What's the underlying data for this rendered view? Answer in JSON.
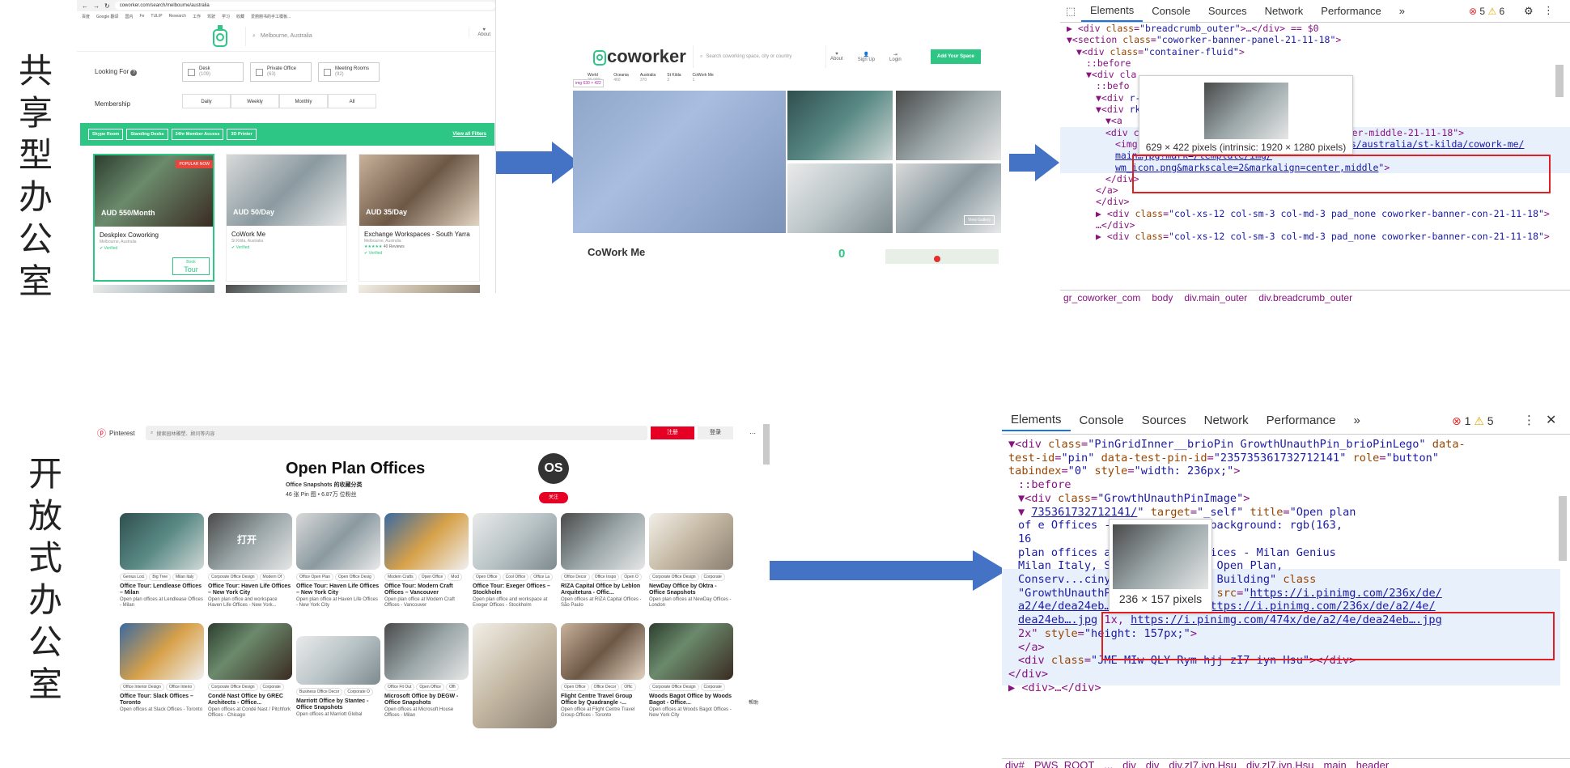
{
  "labels": {
    "top": [
      "共",
      "享",
      "型",
      "办",
      "公",
      "室"
    ],
    "bottom": [
      "开",
      "放",
      "式",
      "办",
      "公",
      "室"
    ]
  },
  "colors": {
    "arrow": "#4472c4",
    "coworker_green": "#2ec685",
    "pinterest_red": "#e60023",
    "highlight_red": "#e02020"
  },
  "coworker_search": {
    "url": "coworker.com/search/melbourne/australia",
    "bookmarks": [
      "百度",
      "Google 翻译",
      "国内",
      "Fe",
      "TULIP",
      "Research",
      "工作",
      "驾驶",
      "学习",
      "收藏",
      "爱丽丽书的手工模板..."
    ],
    "search_placeholder": "Melbourne, Australia",
    "about": "About",
    "looking_for": "Looking For",
    "options": [
      {
        "label": "Desk",
        "count": "(109)"
      },
      {
        "label": "Private Office",
        "count": "(63)"
      },
      {
        "label": "Meeting Rooms",
        "count": "(92)"
      }
    ],
    "membership": "Membership",
    "membership_opts": [
      "Daily",
      "Weekly",
      "Monthly",
      "All"
    ],
    "filters": [
      "Skype Room",
      "Standing Desks",
      "24hr Member Access",
      "3D Printer"
    ],
    "view_all": "View all Filters",
    "cards": [
      {
        "price": "AUD 550/Month",
        "name": "Deskplex Coworking",
        "loc": "Melbourne, Australia",
        "badge": "POPULAR NOW",
        "verified": "Verified",
        "btn_top": "Book",
        "btn_bottom": "Tour"
      },
      {
        "price": "AUD 50/Day",
        "name": "CoWork Me",
        "loc": "St Kilda, Australia",
        "verified": "Verified"
      },
      {
        "price": "AUD 35/Day",
        "name": "Exchange Workspaces - South Yarra",
        "loc": "Melbourne, Australia",
        "reviews": "40 Reviews",
        "verified": "Verified"
      }
    ]
  },
  "coworker_detail": {
    "logo": "coworker",
    "search_placeholder": "Search coworking space, city or country",
    "nav": [
      "About",
      "Sign Up",
      "Login"
    ],
    "cta": "Add Your Space",
    "breadcrumb": [
      {
        "t": "World",
        "n": "20,000+"
      },
      {
        "t": "Oceania",
        "n": "460"
      },
      {
        "t": "Australia",
        "n": "370"
      },
      {
        "t": "St Kilda",
        "n": "3"
      },
      {
        "t": "CoWork Me",
        "n": "1"
      }
    ],
    "img_tip": "img  630 × 422",
    "title": "CoWork Me",
    "count": "0",
    "view_btn": "View Gallery"
  },
  "devtools_top": {
    "tabs": [
      "Elements",
      "Console",
      "Sources",
      "Network",
      "Performance",
      "»"
    ],
    "errors": "5",
    "warnings": "6",
    "lines": [
      {
        "indent": 0,
        "html": "<span class='tag'>▶ &lt;div </span><span class='attr'>class</span>=<span class='val'>\"breadcrumb_outer\"</span><span class='tag'>&gt;…&lt;/div&gt;</span> == $0"
      },
      {
        "indent": 0,
        "html": "<span class='tag'>▼&lt;section </span><span class='attr'>class</span>=<span class='val'>\"coworker-banner-panel-21-11-18\"</span><span class='tag'>&gt;</span>"
      },
      {
        "indent": 1,
        "html": "<span class='tag'>▼&lt;div </span><span class='attr'>class</span>=<span class='val'>\"container-fluid\"</span><span class='tag'>&gt;</span>"
      },
      {
        "indent": 2,
        "html": "::before"
      },
      {
        "indent": 2,
        "html": "<span class='tag'>▼&lt;div cla</span>"
      },
      {
        "indent": 3,
        "html": "::befo"
      },
      {
        "indent": 3,
        "html": "<span class='tag'>▼&lt;div</span>                              <span class='val'>r-outer-21-11-18\"</span><span class='tag'>&gt;</span>"
      },
      {
        "indent": 3,
        "html": "<span class='tag'>▼&lt;div</span>                              <span class='val'>rker-banner-large-pic-21-11-18\"</span><span class='tag'>&gt;</span>"
      },
      {
        "indent": 4,
        "html": "<span class='tag'>▼&lt;a</span>"
      },
      {
        "indent": 4,
        "html": "<span class='tag'>&lt;div class=\"col-xs-12 pad_none coworker-banner-middle-21-11-18\"&gt;</span>"
      },
      {
        "indent": 5,
        "html": "<span class='tag'>&lt;img </span><span class='attr'>src</span>=<span class='val'>\"</span><span class='lnk'>https://coworker.imgix.net/photos/australia/st-kilda/cowork-me/</span>"
      },
      {
        "indent": 5,
        "html": "<span class='lnk'>main…jpg?mark=/template/img/</span>"
      },
      {
        "indent": 5,
        "html": "<span class='lnk'>wm_icon.png&amp;markscale=2&amp;markalign=center,middle</span><span class='val'>\"</span><span class='tag'>&gt;</span>"
      },
      {
        "indent": 4,
        "html": "<span class='tag'>&lt;/div&gt;</span>"
      },
      {
        "indent": 3,
        "html": "<span class='tag'>&lt;/a&gt;</span>"
      },
      {
        "indent": 3,
        "html": "<span class='tag'>&lt;/div&gt;</span>"
      },
      {
        "indent": 3,
        "html": "<span class='tag'>▶ &lt;div </span><span class='attr'>class</span>=<span class='val'>\"col-xs-12 col-sm-3 col-md-3 pad_none coworker-banner-con-21-11-18\"</span><span class='tag'>&gt;</span>"
      },
      {
        "indent": 3,
        "html": "<span class='tag'>…&lt;/div&gt;</span>"
      },
      {
        "indent": 3,
        "html": "<span class='tag'>▶ &lt;div </span><span class='attr'>class</span>=<span class='val'>\"col-xs-12 col-sm-3 col-md-3 pad_none coworker-banner-con-21-11-18\"</span><span class='tag'>&gt;</span>"
      }
    ],
    "tooltip": "629 × 422 pixels (intrinsic: 1920 × 1280 pixels)",
    "crumbs": [
      "gr_coworker_com",
      "body",
      "div.main_outer",
      "div.breadcrumb_outer"
    ]
  },
  "pinterest": {
    "brand": "Pinterest",
    "search_placeholder": "搜索园林雕塑、顾问等内容",
    "signup": "注册",
    "login": "登录",
    "board_title": "Open Plan Offices",
    "owner": "Office Snapshots 的收藏分类",
    "stats": "46 张 Pin 图 • 6.87万 位粉丝",
    "avatar": "OS",
    "follow": "关注",
    "overlay_text": "打开",
    "pins": [
      {
        "t": "Office Tour: Lendlease Offices – Milan",
        "d": "Open plan offices at Lendlease Offices - Milan",
        "tags": [
          "Genius Loci",
          "Big Tree",
          "Milan Italy"
        ]
      },
      {
        "t": "Office Tour: Haven Life Offices – New York City",
        "d": "Open plan office and workspace Haven Life Offices - New York...",
        "tags": [
          "Corporate Office Design",
          "Modern Of"
        ]
      },
      {
        "t": "Office Tour: Haven Life Offices – New York City",
        "d": "Open plan office at Haven Life Offices - New York City",
        "tags": [
          "Office Open Plan",
          "Open Office Desig"
        ]
      },
      {
        "t": "Office Tour: Modern Craft Offices – Vancouver",
        "d": "Open plan office at Modern Craft Offices - Vancouver",
        "tags": [
          "Modern Crafts",
          "Open Office",
          "Mod"
        ]
      },
      {
        "t": "Office Tour: Exeger Offices – Stockholm",
        "d": "Open plan office and workspace at Exeger Offices - Stockholm",
        "tags": [
          "Open Office",
          "Cool Office",
          "Office La"
        ]
      },
      {
        "t": "RIZA Capital Office by Leblon Arquitetura - Offic...",
        "d": "Open offices at RIZA Capital Offices - São Paulo",
        "tags": [
          "Office Decor",
          "Office Inspo",
          "Open O"
        ]
      },
      {
        "t": "NewDay Office by Oktra - Office Snapshots",
        "d": "Open plan offices at NewDay Offices - London",
        "tags": [
          "Corporate Office Design",
          "Corporate"
        ]
      },
      {
        "t": "Office Tour: Slack Offices – Toronto",
        "d": "Open offices at Slack Offices - Toronto",
        "tags": [
          "Office Interior Design",
          "Office Interio"
        ]
      },
      {
        "t": "Condé Nast Office by GREC Architects - Office...",
        "d": "Open offices at Condé Nast / Pitchfork Offices - Chicago",
        "tags": [
          "Corporate Office Design",
          "Corporate"
        ]
      },
      {
        "t": "Marriott Office by Stantec - Office Snapshots",
        "d": "Open offices at Marriott Global",
        "tags": [
          "Business Office Decor",
          "Corporate O"
        ]
      },
      {
        "t": "Microsoft Office by DEGW - Office Snapshots",
        "d": "Open offices at Microsoft House Offices - Milan",
        "tags": [
          "Office Fit Out",
          "Open Office",
          "Offi"
        ]
      },
      {
        "t": "",
        "d": "",
        "tags": []
      },
      {
        "t": "Flight Centre Travel Group Office by Quadrangle -...",
        "d": "Open office at Flight Centre Travel Group Offices - Toronto",
        "tags": [
          "Open Office",
          "Office Decor",
          "Offic"
        ]
      },
      {
        "t": "Woods Bagot Office by Woods Bagot - Office...",
        "d": "Open offices at Woods Bagot Offices - New York City",
        "tags": [
          "Corporate Office Design",
          "Corporate"
        ]
      }
    ],
    "side_label": "帮助"
  },
  "devtools_bottom": {
    "tabs": [
      "Elements",
      "Console",
      "Sources",
      "Network",
      "Performance",
      "»"
    ],
    "errors": "1",
    "warnings": "5",
    "lines": [
      {
        "indent": 0,
        "html": "<span class='tag'>▼&lt;div </span><span class='attr'>class</span>=<span class='val'>\"PinGridInner__brioPin GrowthUnauthPin_brioPinLego\"</span> <span class='attr'>data-</span>"
      },
      {
        "indent": 0,
        "html": "<span class='attr'>test-id</span>=<span class='val'>\"pin\"</span> <span class='attr'>data-test-pin-id</span>=<span class='val'>\"235735361732712141\"</span> <span class='attr'>role</span>=<span class='val'>\"button\"</span>"
      },
      {
        "indent": 0,
        "html": "<span class='attr'>tabindex</span>=<span class='val'>\"0\"</span> <span class='attr'>style</span>=<span class='val'>\"width: 236px;\"</span><span class='tag'>&gt;</span>"
      },
      {
        "indent": 1,
        "html": "::before"
      },
      {
        "indent": 1,
        "html": "<span class='tag'>▼&lt;div </span><span class='attr'>class</span>=<span class='val'>\"GrowthUnauthPinImage\"</span><span class='tag'>&gt;</span>"
      },
      {
        "indent": 1,
        "html": "<span class='tag'>▼</span>              <span class='lnk'>735361732712141/</span><span class='val'>\"</span> <span class='attr'>target</span>=<span class='val'>\"_self\"</span> <span class='attr'>title</span>=<span class='val'>\"Open plan</span>"
      },
      {
        "indent": 1,
        "html": "<span class='val'>of                e Offices - Milan\"</span> <span class='attr'>style</span>=<span class='val'>\"background: rgb(163,</span>"
      },
      {
        "indent": 1,
        "html": "<span class='val'>16</span>"
      },
      {
        "indent": 1,
        "html": "                <span class='val'>plan offices at Lendlease Offices - Milan Genius</span>"
      },
      {
        "indent": 1,
        "html": "                <span class='val'>Milan Italy, Space Furniture, Open Plan,</span>"
      },
      {
        "indent": 1,
        "html": "<span class='val'>Conserv...ciny Layout, Tours, Building\"</span> <span class='attr'>class</span>"
      },
      {
        "indent": 1,
        "html": "<span class='val'>\"GrowthUnauthPinImage__Image\"</span> <span class='attr'>src</span>=<span class='val'>\"</span><span class='lnk'>https://i.pinimg.com/236x/de/</span>"
      },
      {
        "indent": 1,
        "html": "<span class='lnk'>a2/4e/dea24eb….jpg</span><span class='val'>\"</span> <span class='attr'>srcset</span>=<span class='val'>\"</span><span class='lnk'>https://i.pinimg.com/236x/de/a2/4e/</span>"
      },
      {
        "indent": 1,
        "html": "<span class='lnk'>dea24eb….jpg</span> 1x, <span class='lnk'>https://i.pinimg.com/474x/de/a2/4e/dea24eb….jpg</span>"
      },
      {
        "indent": 1,
        "html": "2x\" <span class='attr'>style</span>=<span class='val'>\"height: 157px;\"</span><span class='tag'>&gt;</span>"
      },
      {
        "indent": 1,
        "html": "<span class='tag'>&lt;/a&gt;</span>"
      },
      {
        "indent": 1,
        "html": "<span class='tag'>&lt;div </span><span class='attr'>class</span>=<span class='val'>\"JME MIw QLY Rym hjj zI7 iyn Hsu\"</span><span class='tag'>&gt;&lt;/div&gt;</span>"
      },
      {
        "indent": 0,
        "html": "<span class='tag'>&lt;/div&gt;</span>"
      },
      {
        "indent": 0,
        "html": "<span class='tag'>▶ &lt;div&gt;…&lt;/div&gt;</span>"
      }
    ],
    "tooltip": "236 × 157 pixels",
    "crumbs": [
      "div#",
      "PWS_ROOT",
      "...",
      "div",
      "div",
      "div.zI7.iyn.Hsu",
      "div.zI7.iyn.Hsu",
      "main",
      "header"
    ]
  }
}
